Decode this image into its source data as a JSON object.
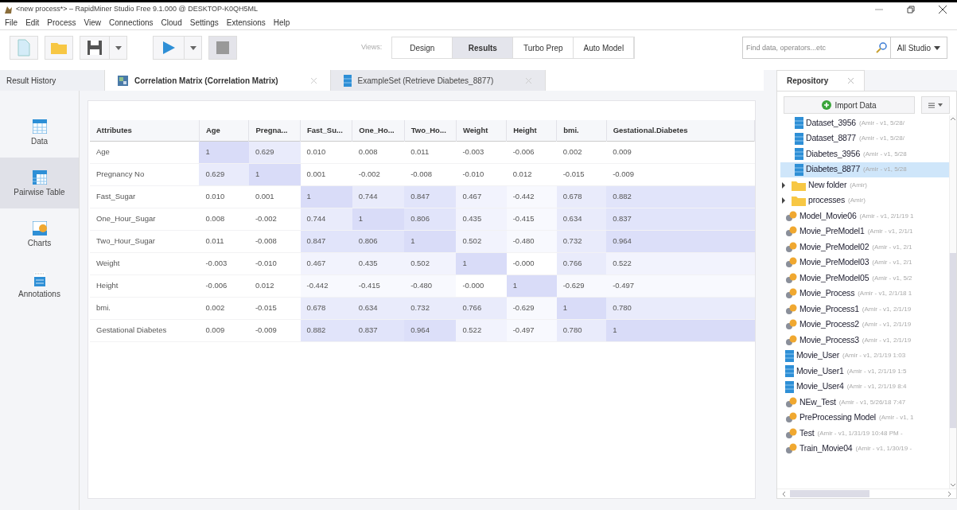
{
  "window": {
    "title": "<new process*> – RapidMiner Studio Free 9.1.000 @ DESKTOP-K0QH5ML"
  },
  "menu": [
    "File",
    "Edit",
    "Process",
    "View",
    "Connections",
    "Cloud",
    "Settings",
    "Extensions",
    "Help"
  ],
  "views": {
    "label": "Views:",
    "buttons": [
      {
        "label": "Design",
        "selected": false
      },
      {
        "label": "Results",
        "selected": true
      },
      {
        "label": "Turbo Prep",
        "selected": false
      },
      {
        "label": "Auto Model",
        "selected": false
      }
    ]
  },
  "search": {
    "placeholder": "Find data, operators...etc",
    "scope": "All Studio"
  },
  "result_history": {
    "label": "Result History"
  },
  "tabs": [
    {
      "label": "Correlation Matrix (Correlation Matrix)",
      "kind": "matrix",
      "selected": true
    },
    {
      "label": "ExampleSet (Retrieve Diabetes_8877)",
      "kind": "data",
      "selected": false
    }
  ],
  "sidebar": [
    {
      "label": "Data",
      "kind": "data",
      "selected": false
    },
    {
      "label": "Pairwise Table",
      "kind": "table",
      "selected": true
    },
    {
      "label": "Charts",
      "kind": "charts",
      "selected": false
    },
    {
      "label": "Annotations",
      "kind": "annotations",
      "selected": false
    }
  ],
  "table": {
    "columns": [
      "Attributes",
      "Age",
      "Pregna...",
      "Fast_Su...",
      "One_Ho...",
      "Two_Ho...",
      "Weight",
      "Height",
      "bmi.",
      "Gestational.Diabetes"
    ],
    "rows": [
      {
        "cells": [
          {
            "v": "Age"
          },
          {
            "v": "1",
            "color": "#d9dcf8"
          },
          {
            "v": "0.629",
            "color": "#e9ebfb"
          },
          {
            "v": "0.010",
            "color": "#ffffff"
          },
          {
            "v": "0.008",
            "color": "#ffffff"
          },
          {
            "v": "0.011",
            "color": "#ffffff"
          },
          {
            "v": "-0.003",
            "color": "#ffffff"
          },
          {
            "v": "-0.006",
            "color": "#ffffff"
          },
          {
            "v": "0.002",
            "color": "#ffffff"
          },
          {
            "v": "0.009",
            "color": "#ffffff"
          }
        ]
      },
      {
        "cells": [
          {
            "v": "Pregnancy No"
          },
          {
            "v": "0.629",
            "color": "#e9ebfb"
          },
          {
            "v": "1",
            "color": "#d9dcf8"
          },
          {
            "v": "0.001",
            "color": "#ffffff"
          },
          {
            "v": "-0.002",
            "color": "#ffffff"
          },
          {
            "v": "-0.008",
            "color": "#ffffff"
          },
          {
            "v": "-0.010",
            "color": "#ffffff"
          },
          {
            "v": "0.012",
            "color": "#ffffff"
          },
          {
            "v": "-0.015",
            "color": "#ffffff"
          },
          {
            "v": "-0.009",
            "color": "#ffffff"
          }
        ]
      },
      {
        "cells": [
          {
            "v": "Fast_Sugar"
          },
          {
            "v": "0.010",
            "color": "#ffffff"
          },
          {
            "v": "0.001",
            "color": "#ffffff"
          },
          {
            "v": "1",
            "color": "#d9dcf8"
          },
          {
            "v": "0.744",
            "color": "#e9ebfb"
          },
          {
            "v": "0.847",
            "color": "#e1e4fa"
          },
          {
            "v": "0.467",
            "color": "#f2f3fd"
          },
          {
            "v": "-0.442",
            "color": "#f8f9fe"
          },
          {
            "v": "0.678",
            "color": "#e9ebfb"
          },
          {
            "v": "0.882",
            "color": "#e1e4fa"
          }
        ]
      },
      {
        "cells": [
          {
            "v": "One_Hour_Sugar"
          },
          {
            "v": "0.008",
            "color": "#ffffff"
          },
          {
            "v": "-0.002",
            "color": "#ffffff"
          },
          {
            "v": "0.744",
            "color": "#e9ebfb"
          },
          {
            "v": "1",
            "color": "#d9dcf8"
          },
          {
            "v": "0.806",
            "color": "#e1e4fa"
          },
          {
            "v": "0.435",
            "color": "#f2f3fd"
          },
          {
            "v": "-0.415",
            "color": "#f8f9fe"
          },
          {
            "v": "0.634",
            "color": "#e9ebfb"
          },
          {
            "v": "0.837",
            "color": "#e1e4fa"
          }
        ]
      },
      {
        "cells": [
          {
            "v": "Two_Hour_Sugar"
          },
          {
            "v": "0.011",
            "color": "#ffffff"
          },
          {
            "v": "-0.008",
            "color": "#ffffff"
          },
          {
            "v": "0.847",
            "color": "#e1e4fa"
          },
          {
            "v": "0.806",
            "color": "#e1e4fa"
          },
          {
            "v": "1",
            "color": "#d9dcf8"
          },
          {
            "v": "0.502",
            "color": "#f2f3fd"
          },
          {
            "v": "-0.480",
            "color": "#f8f9fe"
          },
          {
            "v": "0.732",
            "color": "#e9ebfb"
          },
          {
            "v": "0.964",
            "color": "#dcdff9"
          }
        ]
      },
      {
        "cells": [
          {
            "v": "Weight"
          },
          {
            "v": "-0.003",
            "color": "#ffffff"
          },
          {
            "v": "-0.010",
            "color": "#ffffff"
          },
          {
            "v": "0.467",
            "color": "#f2f3fd"
          },
          {
            "v": "0.435",
            "color": "#f2f3fd"
          },
          {
            "v": "0.502",
            "color": "#f2f3fd"
          },
          {
            "v": "1",
            "color": "#d9dcf8"
          },
          {
            "v": "-0.000",
            "color": "#ffffff"
          },
          {
            "v": "0.766",
            "color": "#e9ebfb"
          },
          {
            "v": "0.522",
            "color": "#f2f3fd"
          }
        ]
      },
      {
        "cells": [
          {
            "v": "Height"
          },
          {
            "v": "-0.006",
            "color": "#ffffff"
          },
          {
            "v": "0.012",
            "color": "#ffffff"
          },
          {
            "v": "-0.442",
            "color": "#f8f9fe"
          },
          {
            "v": "-0.415",
            "color": "#f8f9fe"
          },
          {
            "v": "-0.480",
            "color": "#f8f9fe"
          },
          {
            "v": "-0.000",
            "color": "#ffffff"
          },
          {
            "v": "1",
            "color": "#d9dcf8"
          },
          {
            "v": "-0.629",
            "color": "#f8f9fe"
          },
          {
            "v": "-0.497",
            "color": "#f8f9fe"
          }
        ]
      },
      {
        "cells": [
          {
            "v": "bmi."
          },
          {
            "v": "0.002",
            "color": "#ffffff"
          },
          {
            "v": "-0.015",
            "color": "#ffffff"
          },
          {
            "v": "0.678",
            "color": "#e9ebfb"
          },
          {
            "v": "0.634",
            "color": "#e9ebfb"
          },
          {
            "v": "0.732",
            "color": "#e9ebfb"
          },
          {
            "v": "0.766",
            "color": "#e9ebfb"
          },
          {
            "v": "-0.629",
            "color": "#f8f9fe"
          },
          {
            "v": "1",
            "color": "#d9dcf8"
          },
          {
            "v": "0.780",
            "color": "#e9ebfb"
          }
        ]
      },
      {
        "cells": [
          {
            "v": "Gestational Diabetes"
          },
          {
            "v": "0.009",
            "color": "#ffffff"
          },
          {
            "v": "-0.009",
            "color": "#ffffff"
          },
          {
            "v": "0.882",
            "color": "#e1e4fa"
          },
          {
            "v": "0.837",
            "color": "#e1e4fa"
          },
          {
            "v": "0.964",
            "color": "#dcdff9"
          },
          {
            "v": "0.522",
            "color": "#f2f3fd"
          },
          {
            "v": "-0.497",
            "color": "#f8f9fe"
          },
          {
            "v": "0.780",
            "color": "#e9ebfb"
          },
          {
            "v": "1",
            "color": "#d9dcf8"
          }
        ]
      }
    ]
  },
  "repository": {
    "title": "Repository",
    "import_button": "Import Data",
    "partial_children": [
      {
        "name": "Dataset_3956",
        "meta": "(Amir - v1, 5/28/",
        "kind": "data",
        "selected": false
      },
      {
        "name": "Dataset_8877",
        "meta": "(Amir - v1, 5/28/",
        "kind": "data",
        "selected": false
      },
      {
        "name": "Diabetes_3956",
        "meta": "(Amir - v1, 5/28",
        "kind": "data",
        "selected": false
      },
      {
        "name": "Diabetes_8877",
        "meta": "(Amir - v1, 5/28",
        "kind": "data",
        "selected": true
      }
    ],
    "items": [
      {
        "name": "New folder",
        "meta": "(Amir)",
        "kind": "folder",
        "selected": false
      },
      {
        "name": "processes",
        "meta": "(Amir)",
        "kind": "folder",
        "selected": false
      },
      {
        "name": "Model_Movie06",
        "meta": "(Amir - v1, 2/1/19 1",
        "kind": "process",
        "selected": false
      },
      {
        "name": "Movie_PreModel1",
        "meta": "(Amir - v1, 2/1/1",
        "kind": "process",
        "selected": false
      },
      {
        "name": "Movie_PreModel02",
        "meta": "(Amir - v1, 2/1",
        "kind": "process",
        "selected": false
      },
      {
        "name": "Movie_PreModel03",
        "meta": "(Amir - v1, 2/1",
        "kind": "process",
        "selected": false
      },
      {
        "name": "Movie_PreModel05",
        "meta": "(Amir - v1, 5/2",
        "kind": "process",
        "selected": false
      },
      {
        "name": "Movie_Process",
        "meta": "(Amir - v1, 2/1/18 1",
        "kind": "process",
        "selected": false
      },
      {
        "name": "Movie_Process1",
        "meta": "(Amir - v1, 2/1/19",
        "kind": "process",
        "selected": false
      },
      {
        "name": "Movie_Process2",
        "meta": "(Amir - v1, 2/1/19",
        "kind": "process",
        "selected": false
      },
      {
        "name": "Movie_Process3",
        "meta": "(Amir - v1, 2/1/19",
        "kind": "process",
        "selected": false
      },
      {
        "name": "Movie_User",
        "meta": "(Amir - v1, 2/1/19 1:03",
        "kind": "data",
        "selected": false
      },
      {
        "name": "Movie_User1",
        "meta": "(Amir - v1, 2/1/19 1:5",
        "kind": "data",
        "selected": false
      },
      {
        "name": "Movie_User4",
        "meta": "(Amir - v1, 2/1/19 8:4",
        "kind": "data",
        "selected": false
      },
      {
        "name": "NEw_Test",
        "meta": "(Amir - v1, 5/26/18 7:47",
        "kind": "process",
        "selected": false
      },
      {
        "name": "PreProcessing Model",
        "meta": "(Amir - v1, 1",
        "kind": "process",
        "selected": false
      },
      {
        "name": "Test",
        "meta": "(Amir - v1, 1/31/19 10:48 PM -",
        "kind": "process",
        "selected": false
      },
      {
        "name": "Train_Movie04",
        "meta": "(Amir - v1, 1/30/19 -",
        "kind": "process",
        "selected": false
      }
    ]
  }
}
